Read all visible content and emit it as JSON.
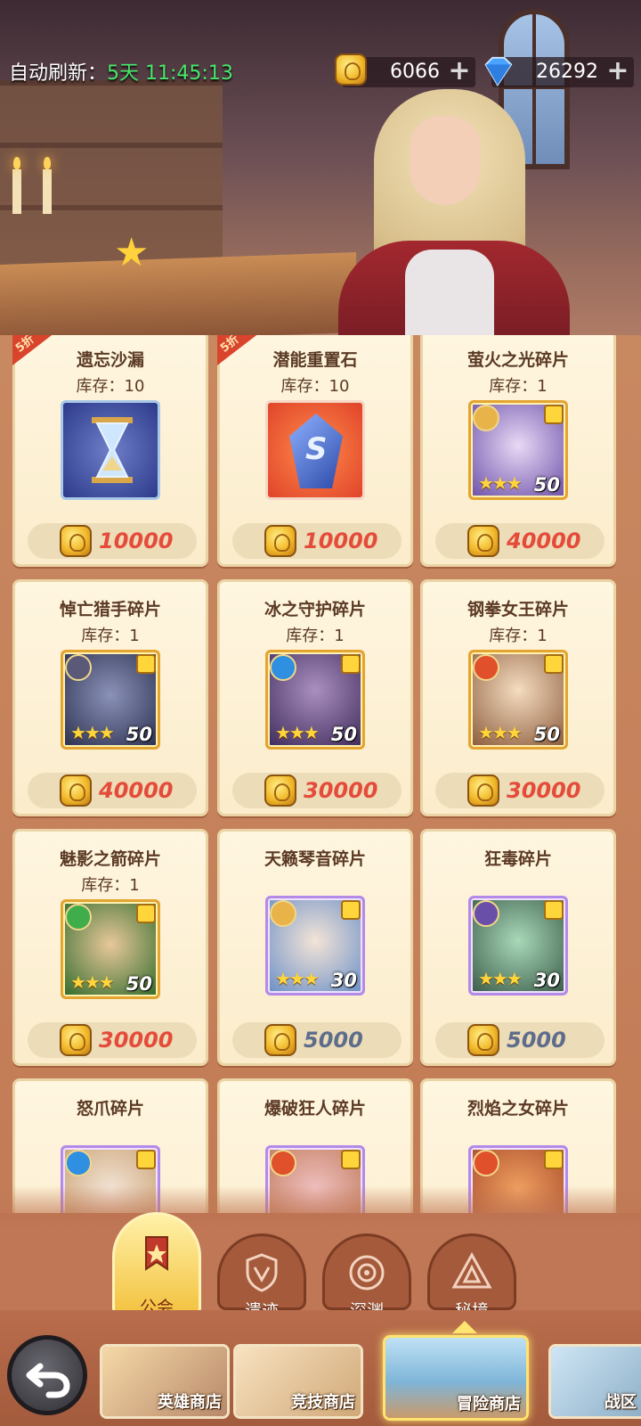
{
  "header": {
    "refresh_label": "自动刷新：",
    "refresh_value": "5天 11:45:13",
    "gold_amount": "6066",
    "gem_amount": "26292"
  },
  "shop": {
    "items": [
      {
        "name": "遗忘沙漏",
        "stock": "库存：10",
        "price": "10000",
        "sale": "5折",
        "art": "hourglass-icon"
      },
      {
        "name": "潜能重置石",
        "stock": "库存：10",
        "price": "10000",
        "sale": "5折",
        "art": "reset-stone-icon"
      },
      {
        "name": "萤火之光碎片",
        "stock": "库存：1",
        "price": "40000",
        "level": "50",
        "art": "hero-portrait"
      },
      {
        "name": "悼亡猎手碎片",
        "stock": "库存：1",
        "price": "40000",
        "level": "50",
        "art": "hero-portrait"
      },
      {
        "name": "冰之守护碎片",
        "stock": "库存：1",
        "price": "30000",
        "level": "50",
        "art": "hero-portrait"
      },
      {
        "name": "钢拳女王碎片",
        "stock": "库存：1",
        "price": "30000",
        "level": "50",
        "art": "hero-portrait"
      },
      {
        "name": "魅影之箭碎片",
        "stock": "库存：1",
        "price": "30000",
        "level": "50",
        "art": "hero-portrait"
      },
      {
        "name": "天籁琴音碎片",
        "stock": "",
        "price": "5000",
        "level": "30",
        "art": "hero-portrait"
      },
      {
        "name": "狂毒碎片",
        "stock": "",
        "price": "5000",
        "level": "30",
        "art": "hero-portrait"
      },
      {
        "name": "怒爪碎片",
        "stock": "",
        "price": "",
        "art": "hero-portrait"
      },
      {
        "name": "爆破狂人碎片",
        "stock": "",
        "price": "",
        "art": "hero-portrait"
      },
      {
        "name": "烈焰之女碎片",
        "stock": "",
        "price": "",
        "art": "hero-portrait"
      }
    ]
  },
  "guild_tabs": [
    {
      "label": "公会",
      "active": true
    },
    {
      "label": "遗迹",
      "active": false
    },
    {
      "label": "深渊",
      "active": false
    },
    {
      "label": "秘境",
      "active": false
    }
  ],
  "shop_nav": [
    {
      "label": "英雄商店",
      "active": false
    },
    {
      "label": "竞技商店",
      "active": false
    },
    {
      "label": "冒险商店",
      "active": true
    },
    {
      "label": "战区",
      "active": false
    }
  ],
  "colors": {
    "price_red": "#e54b3a",
    "price_blue": "#5e6d8c",
    "timer_green": "#48e86a",
    "active_gold": "#ffe470"
  }
}
